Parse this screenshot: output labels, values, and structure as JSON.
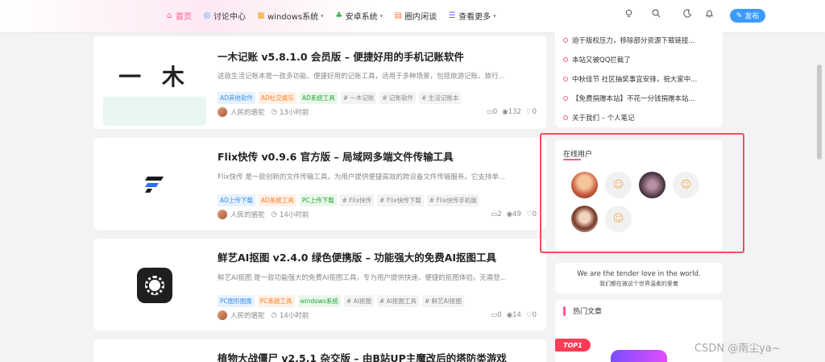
{
  "nav": {
    "items": [
      {
        "label": "首页",
        "icon": "home-icon",
        "glyph": "⌂"
      },
      {
        "label": "讨论中心",
        "icon": "discussion-icon",
        "glyph": "◎"
      },
      {
        "label": "windows系统",
        "icon": "windows-icon",
        "glyph": "▦",
        "caret": "▾"
      },
      {
        "label": "安卓系统",
        "icon": "android-icon",
        "glyph": "♣",
        "caret": "▾"
      },
      {
        "label": "圈内闲谈",
        "icon": "chat-icon",
        "glyph": "▤"
      },
      {
        "label": "查看更多",
        "icon": "more-icon",
        "glyph": "☰",
        "caret": "▾"
      }
    ],
    "publish_label": "发布"
  },
  "posts": [
    {
      "title": "一木记账 v5.8.1.0 会员版 – 便捷好用的手机记账软件",
      "desc": "这款生活记账本是一款多功能、便捷好用的记账工具，适用于多种场景，包括旅游记账、旅行...",
      "tags": [
        {
          "label": "AD其他软件",
          "style": "blue"
        },
        {
          "label": "AD社交娱乐",
          "style": "orange"
        },
        {
          "label": "AD系统工具",
          "style": "green"
        },
        {
          "label": "# 一木记账",
          "style": "grey"
        },
        {
          "label": "# 记账软件",
          "style": "grey"
        },
        {
          "label": "# 生活记账本",
          "style": "grey"
        }
      ],
      "author": "人民的骆驼",
      "time": "13小时前",
      "comments": "0",
      "views": "132",
      "likes": "0"
    },
    {
      "title": "Flix快传 v0.9.6 官方版 – 局域网多端文件传输工具",
      "desc": "Flix快传 是一款创新的文件传输工具，为用户提供便捷高效的跨设备文件传输服务。它支持单...",
      "tags": [
        {
          "label": "AD上传下载",
          "style": "blue"
        },
        {
          "label": "AD系统工具",
          "style": "orange"
        },
        {
          "label": "PC上传下载",
          "style": "green"
        },
        {
          "label": "# Flix快传",
          "style": "grey"
        },
        {
          "label": "# Flix快传下载",
          "style": "grey"
        },
        {
          "label": "# Flix快传手机版",
          "style": "grey"
        }
      ],
      "author": "人民的骆驼",
      "time": "14小时前",
      "comments": "2",
      "views": "49",
      "likes": "0"
    },
    {
      "title": "鲜艺AI抠图 v2.4.0 绿色便携版 – 功能强大的免费AI抠图工具",
      "desc": "鲜艺AI抠图 是一款功能强大的免费AI抠图工具，专为用户提供快速、便捷的抠图体验。无需登...",
      "tags": [
        {
          "label": "PC图形图像",
          "style": "blue"
        },
        {
          "label": "PC系统工具",
          "style": "orange"
        },
        {
          "label": "windows系统",
          "style": "green"
        },
        {
          "label": "# AI抠图",
          "style": "grey"
        },
        {
          "label": "# AI抠图工具",
          "style": "grey"
        },
        {
          "label": "# 鲜艺AI抠图",
          "style": "grey"
        }
      ],
      "author": "人民的骆驼",
      "time": "14小时前",
      "comments": "0",
      "views": "14",
      "likes": "0"
    },
    {
      "title": "植物大战僵尸 v2.5.1 杂交版 – 由B站UP主魔改后的塔防类游戏"
    }
  ],
  "thumb1_text": "一 木",
  "notices": [
    "迫于版权压力，移除部分资源下载链接...",
    "本站又被QQ拦截了",
    "中秋佳节 社区抽奖事宜安排，祝大家中...",
    "【免费捐赠本站】不花一分钱捐赠本站...",
    "关于我们 – 个人笔记"
  ],
  "online": {
    "title": "在线用户",
    "users": [
      "avatar-photo",
      "avatar-default",
      "avatar-photo",
      "avatar-default",
      "avatar-photo",
      "avatar-default"
    ]
  },
  "motto": {
    "en": "We are the tender love in the world.",
    "zh": "我们都在被这个世界温柔的爱着"
  },
  "hot": {
    "title": "热门文章",
    "badge": "TOP1"
  },
  "watermark": "CSDN @南尘ya~",
  "colors": {
    "accent": "#ff5a8a",
    "highlight": "#f0525e",
    "publish": "#3d9bff"
  }
}
